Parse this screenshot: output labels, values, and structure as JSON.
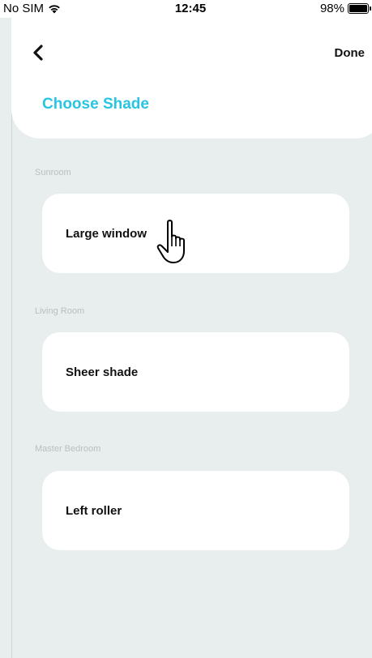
{
  "status_bar": {
    "carrier": "No SIM",
    "time": "12:45",
    "battery": "98%",
    "battery_level": 0.98,
    "wifi_icon": "wifi-icon"
  },
  "header": {
    "back_icon": "chevron-left-icon",
    "done_label": "Done",
    "title": "Choose Shade",
    "title_color": "#29c4e3"
  },
  "sections": [
    {
      "room": "Sunroom",
      "shade": "Large window"
    },
    {
      "room": "Living Room",
      "shade": "Sheer shade"
    },
    {
      "room": "Master Bedroom",
      "shade": "Left roller"
    }
  ],
  "background_color": "#e8eeee"
}
